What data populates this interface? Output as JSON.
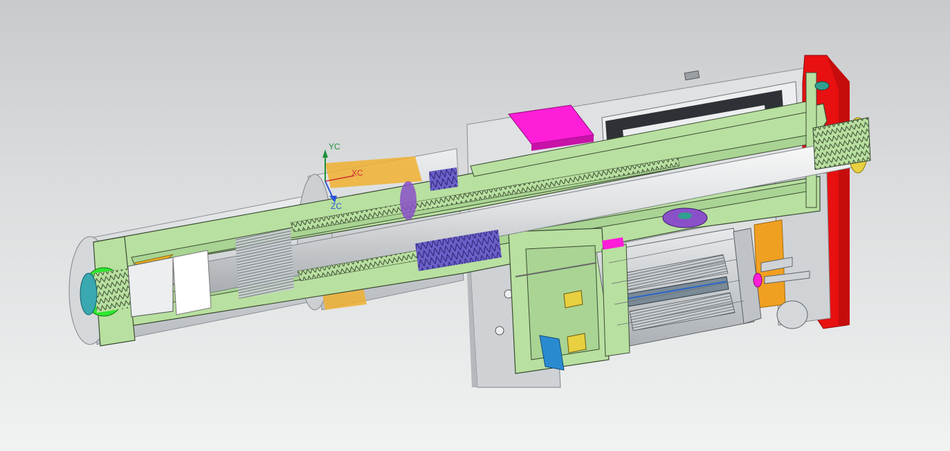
{
  "viewport": {
    "background_top": "#c8cacc",
    "background_bottom": "#f1f2f2"
  },
  "triad": {
    "y_label": "YC",
    "x_label": "XC",
    "z_label": "ZC",
    "y_color": "#1f8f3a",
    "x_color": "#d03030",
    "z_color": "#2a55d8"
  },
  "palette": {
    "section_fill": "#b8e0a0",
    "section_edge": "#3a4a32",
    "housing": "#d7d9dc",
    "shaft": "#e6e8ea",
    "magenta_block": "#ff1ed8",
    "red_plate": "#e81010",
    "orange_parts": "#f0a020",
    "green_nut": "#2ee82e",
    "purple_bearing": "#8a50c8",
    "yellow_ring": "#e8d040",
    "teal_disk": "#30a0c0"
  }
}
